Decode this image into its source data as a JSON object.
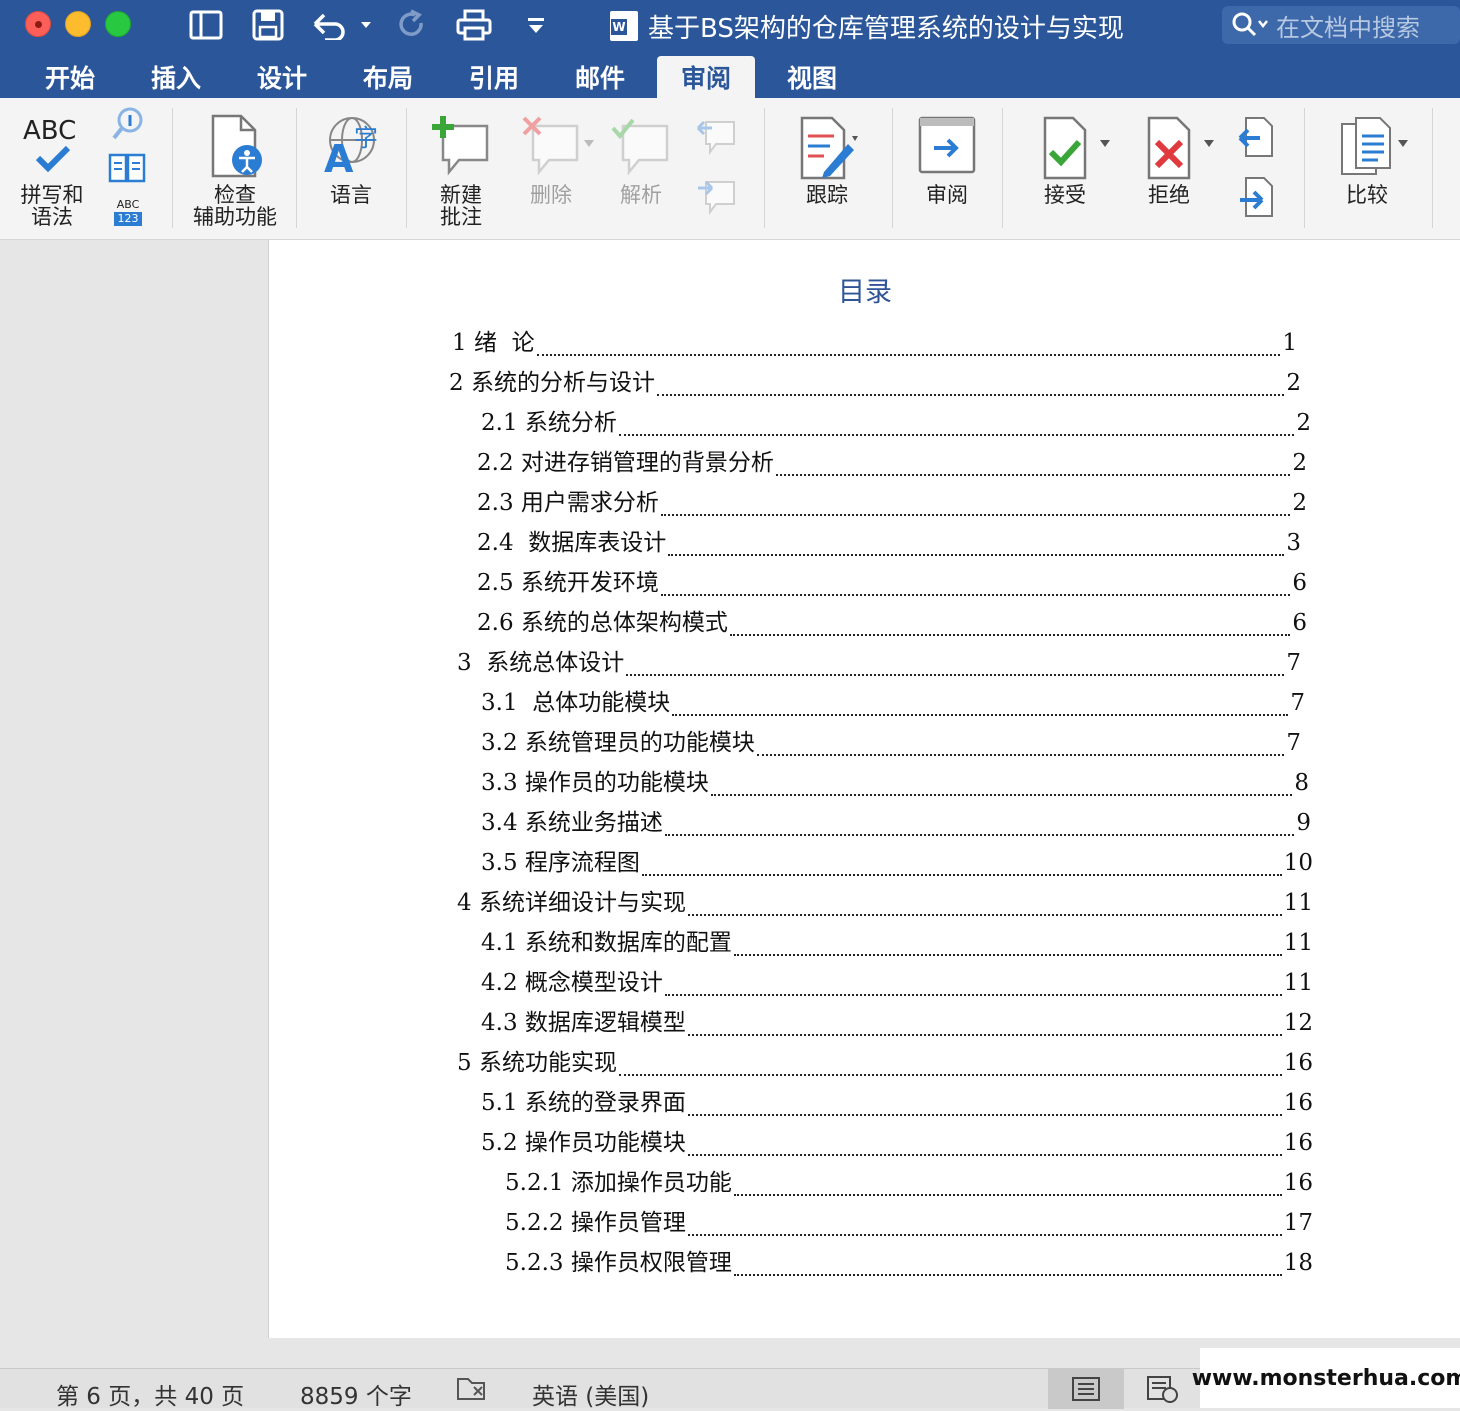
{
  "window": {
    "title": "基于BS架构的仓库管理系统的设计与实现",
    "search_placeholder": "在文档中搜索"
  },
  "tabs": [
    {
      "label": "开始"
    },
    {
      "label": "插入"
    },
    {
      "label": "设计"
    },
    {
      "label": "布局"
    },
    {
      "label": "引用"
    },
    {
      "label": "邮件"
    },
    {
      "label": "审阅",
      "active": true
    },
    {
      "label": "视图"
    }
  ],
  "ribbon": {
    "spelling": "拼写和\n语法",
    "accessibility": "检查\n辅助功能",
    "language": "语言",
    "new_comment": "新建\n批注",
    "delete": "删除",
    "resolve": "解析",
    "tracking": "跟踪",
    "review": "审阅",
    "accept": "接受",
    "reject": "拒绝",
    "compare": "比较",
    "abc_label": "ABC",
    "abc_small": "ABC",
    "abc_123": "123"
  },
  "document": {
    "toc_title": "目录",
    "toc": [
      {
        "text": "1 绪  论",
        "page": "1"
      },
      {
        "text": "2 系统的分析与设计",
        "page": "2"
      },
      {
        "text": "2.1 系统分析",
        "page": "2"
      },
      {
        "text": "2.2 对进存销管理的背景分析",
        "page": "2"
      },
      {
        "text": "2.3 用户需求分析",
        "page": "2"
      },
      {
        "text": "2.4  数据库表设计",
        "page": "3"
      },
      {
        "text": "2.5 系统开发环境",
        "page": "6"
      },
      {
        "text": "2.6 系统的总体架构模式",
        "page": "6"
      },
      {
        "text": "3  系统总体设计",
        "page": "7"
      },
      {
        "text": "3.1  总体功能模块",
        "page": "7"
      },
      {
        "text": "3.2 系统管理员的功能模块",
        "page": "7"
      },
      {
        "text": "3.3 操作员的功能模块",
        "page": "8"
      },
      {
        "text": "3.4 系统业务描述",
        "page": "9"
      },
      {
        "text": "3.5 程序流程图",
        "page": "10"
      },
      {
        "text": "4 系统详细设计与实现",
        "page": "11"
      },
      {
        "text": "4.1 系统和数据库的配置",
        "page": "11"
      },
      {
        "text": "4.2 概念模型设计",
        "page": "11"
      },
      {
        "text": "4.3 数据库逻辑模型",
        "page": "12"
      },
      {
        "text": "5 系统功能实现",
        "page": "16"
      },
      {
        "text": "5.1 系统的登录界面",
        "page": "16"
      },
      {
        "text": "5.2 操作员功能模块",
        "page": "16"
      },
      {
        "text": "5.2.1 添加操作员功能",
        "page": "16"
      },
      {
        "text": "5.2.2 操作员管理",
        "page": "17"
      },
      {
        "text": "5.2.3 操作员权限管理",
        "page": "18"
      }
    ]
  },
  "status": {
    "page": "第 6 页，共 40 页",
    "words": "8859 个字",
    "language": "英语 (美国)"
  },
  "watermark": "www.monsterhua.com",
  "colors": {
    "brand": "#2b579a",
    "toc_title": "#2f5597"
  }
}
